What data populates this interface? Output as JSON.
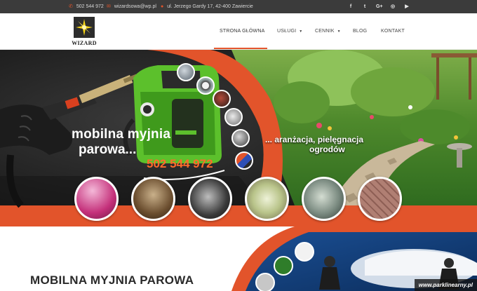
{
  "topbar": {
    "phone": "502 544 972",
    "email": "wizardsowa@wp.pl",
    "address": "ul. Jerzego Gardy 17, 42-400 Zawiercie",
    "icons": [
      "phone-icon",
      "envelope-icon",
      "map-pin-icon"
    ],
    "socials": [
      {
        "name": "facebook-icon",
        "glyph": "f"
      },
      {
        "name": "twitter-icon",
        "glyph": "t"
      },
      {
        "name": "google-plus-icon",
        "glyph": "G+"
      },
      {
        "name": "instagram-icon",
        "glyph": "◎"
      },
      {
        "name": "youtube-icon",
        "glyph": "▶"
      }
    ]
  },
  "logo": {
    "text": "WIZARD"
  },
  "nav": {
    "items": [
      {
        "label": "STRONA GŁÓWNA",
        "active": true
      },
      {
        "label": "USŁUGI",
        "dropdown": true
      },
      {
        "label": "CENNIK",
        "dropdown": true
      },
      {
        "label": "BLOG"
      },
      {
        "label": "KONTAKT"
      }
    ]
  },
  "hero": {
    "title_line1": "mobilna myjnia",
    "title_line2": "parowa...",
    "phone": "502 544 972",
    "garden_line1": "... aranżacja, pielęgnacja",
    "garden_line2": "ogrodów"
  },
  "section": {
    "title": "MOBILNA MYJNIA PAROWA"
  },
  "watermark": {
    "text": "www.parklinearny.pl"
  },
  "colors": {
    "accent": "#e2542b",
    "topbar": "#3b3b3b",
    "steamer": "#5cc02c"
  }
}
